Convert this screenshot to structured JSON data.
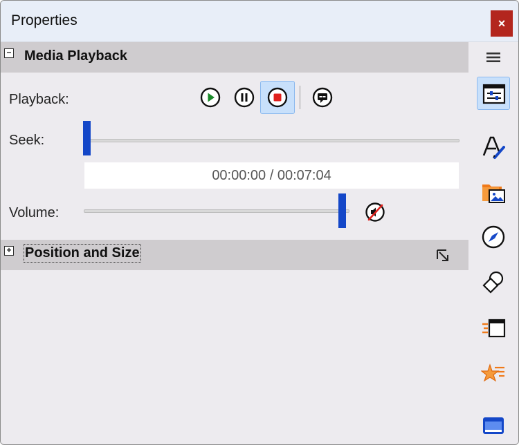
{
  "window": {
    "title": "Properties",
    "close_symbol": "×"
  },
  "sections": {
    "media_playback": {
      "title": "Media Playback",
      "expander": "−",
      "expanded": true
    },
    "position_size": {
      "title": "Position and Size",
      "expander": "+",
      "expanded": false
    }
  },
  "playback": {
    "label": "Playback:",
    "buttons": [
      "play-icon",
      "pause-icon",
      "stop-icon",
      "subtitle-icon"
    ],
    "active_button": "stop"
  },
  "seek": {
    "label": "Seek:",
    "position_fraction": 0.0,
    "time_display": "00:00:00 / 00:07:04"
  },
  "volume": {
    "label": "Volume:",
    "level_fraction": 0.98,
    "muted": true
  },
  "sidebar": {
    "menu_icon": "hamburger-menu-icon",
    "items": [
      {
        "name": "media-properties-icon",
        "active": true
      },
      {
        "name": "text-style-icon",
        "active": false
      },
      {
        "name": "image-folder-icon",
        "active": false
      },
      {
        "name": "navigation-compass-icon",
        "active": false
      },
      {
        "name": "shapes-icon",
        "active": false
      },
      {
        "name": "transition-icon",
        "active": false
      },
      {
        "name": "animation-star-icon",
        "active": false
      },
      {
        "name": "frame-icon",
        "active": false
      }
    ]
  },
  "colors": {
    "accent_blue": "#1447c8",
    "close_red": "#b3261e",
    "active_highlight": "#c8e0fb",
    "play_green": "#1a8a2a",
    "stop_red": "#e0201c",
    "icon_orange": "#f07a1a"
  }
}
